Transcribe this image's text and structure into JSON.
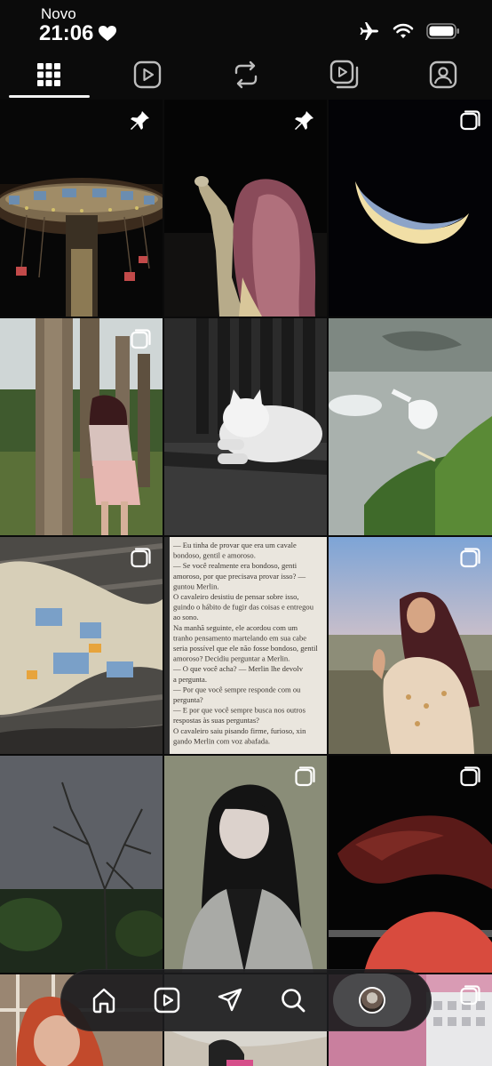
{
  "status_bar": {
    "carrier": "Novo",
    "time": "21:06"
  },
  "tabs": [
    {
      "name": "grid",
      "icon": "grid-icon",
      "active": true
    },
    {
      "name": "reels",
      "icon": "reels-icon",
      "active": false
    },
    {
      "name": "reposts",
      "icon": "repost-icon",
      "active": false
    },
    {
      "name": "collabs",
      "icon": "collab-icon",
      "active": false
    },
    {
      "name": "tagged",
      "icon": "tagged-icon",
      "active": false
    }
  ],
  "posts": [
    {
      "subject": "carousel ride at night",
      "badge": "pin-icon"
    },
    {
      "subject": "girl reaching toward night sky",
      "badge": "pin-icon"
    },
    {
      "subject": "crescent moon",
      "badge": "carousel-icon"
    },
    {
      "subject": "girl leaning on tree",
      "badge": "carousel-icon"
    },
    {
      "subject": "white cat on bench",
      "badge": "none"
    },
    {
      "subject": "swans on lake",
      "badge": "none"
    },
    {
      "subject": "newspaper and jeans",
      "badge": "carousel-icon"
    },
    {
      "subject": "book page",
      "badge": "none"
    },
    {
      "subject": "smiling girl at sunset",
      "badge": "carousel-icon"
    },
    {
      "subject": "bare tree at dusk",
      "badge": "none"
    },
    {
      "subject": "portrait of girl",
      "badge": "carousel-icon"
    },
    {
      "subject": "hair flip at night",
      "badge": "carousel-icon"
    },
    {
      "subject": "laughing girl",
      "badge": "none"
    },
    {
      "subject": "person in light",
      "badge": "none"
    },
    {
      "subject": "pink building",
      "badge": "carousel-icon"
    }
  ],
  "book_page_lines": [
    "— Eu tinha de provar que era um cavale",
    "bondoso, gentil e amoroso.",
    "— Se você realmente era bondoso, genti",
    "amoroso, por que precisava provar isso? —",
    "guntou Merlin.",
    "O cavaleiro desistiu de pensar sobre isso,",
    "guindo o hábito de fugir das coisas e entregou",
    "ao sono.",
    "Na manhã seguinte, ele acordou com um",
    "tranho pensamento martelando em sua cabe",
    "seria possível que ele não fosse bondoso, gentil",
    "amoroso? Decidiu perguntar a Merlin.",
    "— O que você acha? — Merlin lhe devolv",
    "a pergunta.",
    "— Por que você sempre responde com ou",
    "pergunta?",
    "— E por que você sempre busca nos outros",
    "respostas às suas perguntas?",
    "O cavaleiro saiu pisando firme, furioso, xin",
    "gando Merlin com voz abafada."
  ],
  "bottom_nav": [
    {
      "name": "home",
      "icon": "home-icon",
      "active": false
    },
    {
      "name": "reels",
      "icon": "reels-icon",
      "active": false
    },
    {
      "name": "messages",
      "icon": "send-icon",
      "active": false
    },
    {
      "name": "search",
      "icon": "search-icon",
      "active": false
    },
    {
      "name": "profile",
      "icon": "avatar",
      "active": true
    }
  ],
  "colors": {
    "background": "#0b0b0b",
    "nav_bg": "#1c1c1e",
    "active_pill": "#4a4a4c",
    "icon": "#ffffff"
  }
}
